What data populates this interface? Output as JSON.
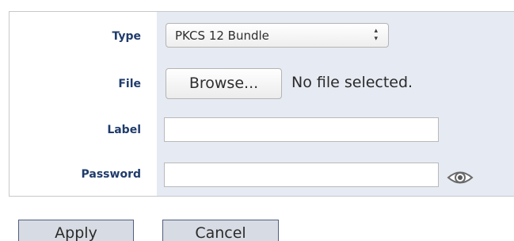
{
  "form": {
    "type": {
      "label": "Type",
      "selected": "PKCS 12 Bundle"
    },
    "file": {
      "label": "File",
      "browse_label": "Browse...",
      "status": "No file selected."
    },
    "label_field": {
      "label": "Label",
      "value": ""
    },
    "password_field": {
      "label": "Password",
      "value": ""
    }
  },
  "actions": {
    "apply_label": "Apply",
    "cancel_label": "Cancel"
  },
  "icons": {
    "select_arrows": "chevron-up-down-icon",
    "password_toggle": "eye-icon"
  },
  "colors": {
    "label_text": "#1f3b6b",
    "field_panel_bg": "#e6eaf3",
    "button_bg": "#d7dbe3",
    "button_border": "#4f5f80"
  }
}
